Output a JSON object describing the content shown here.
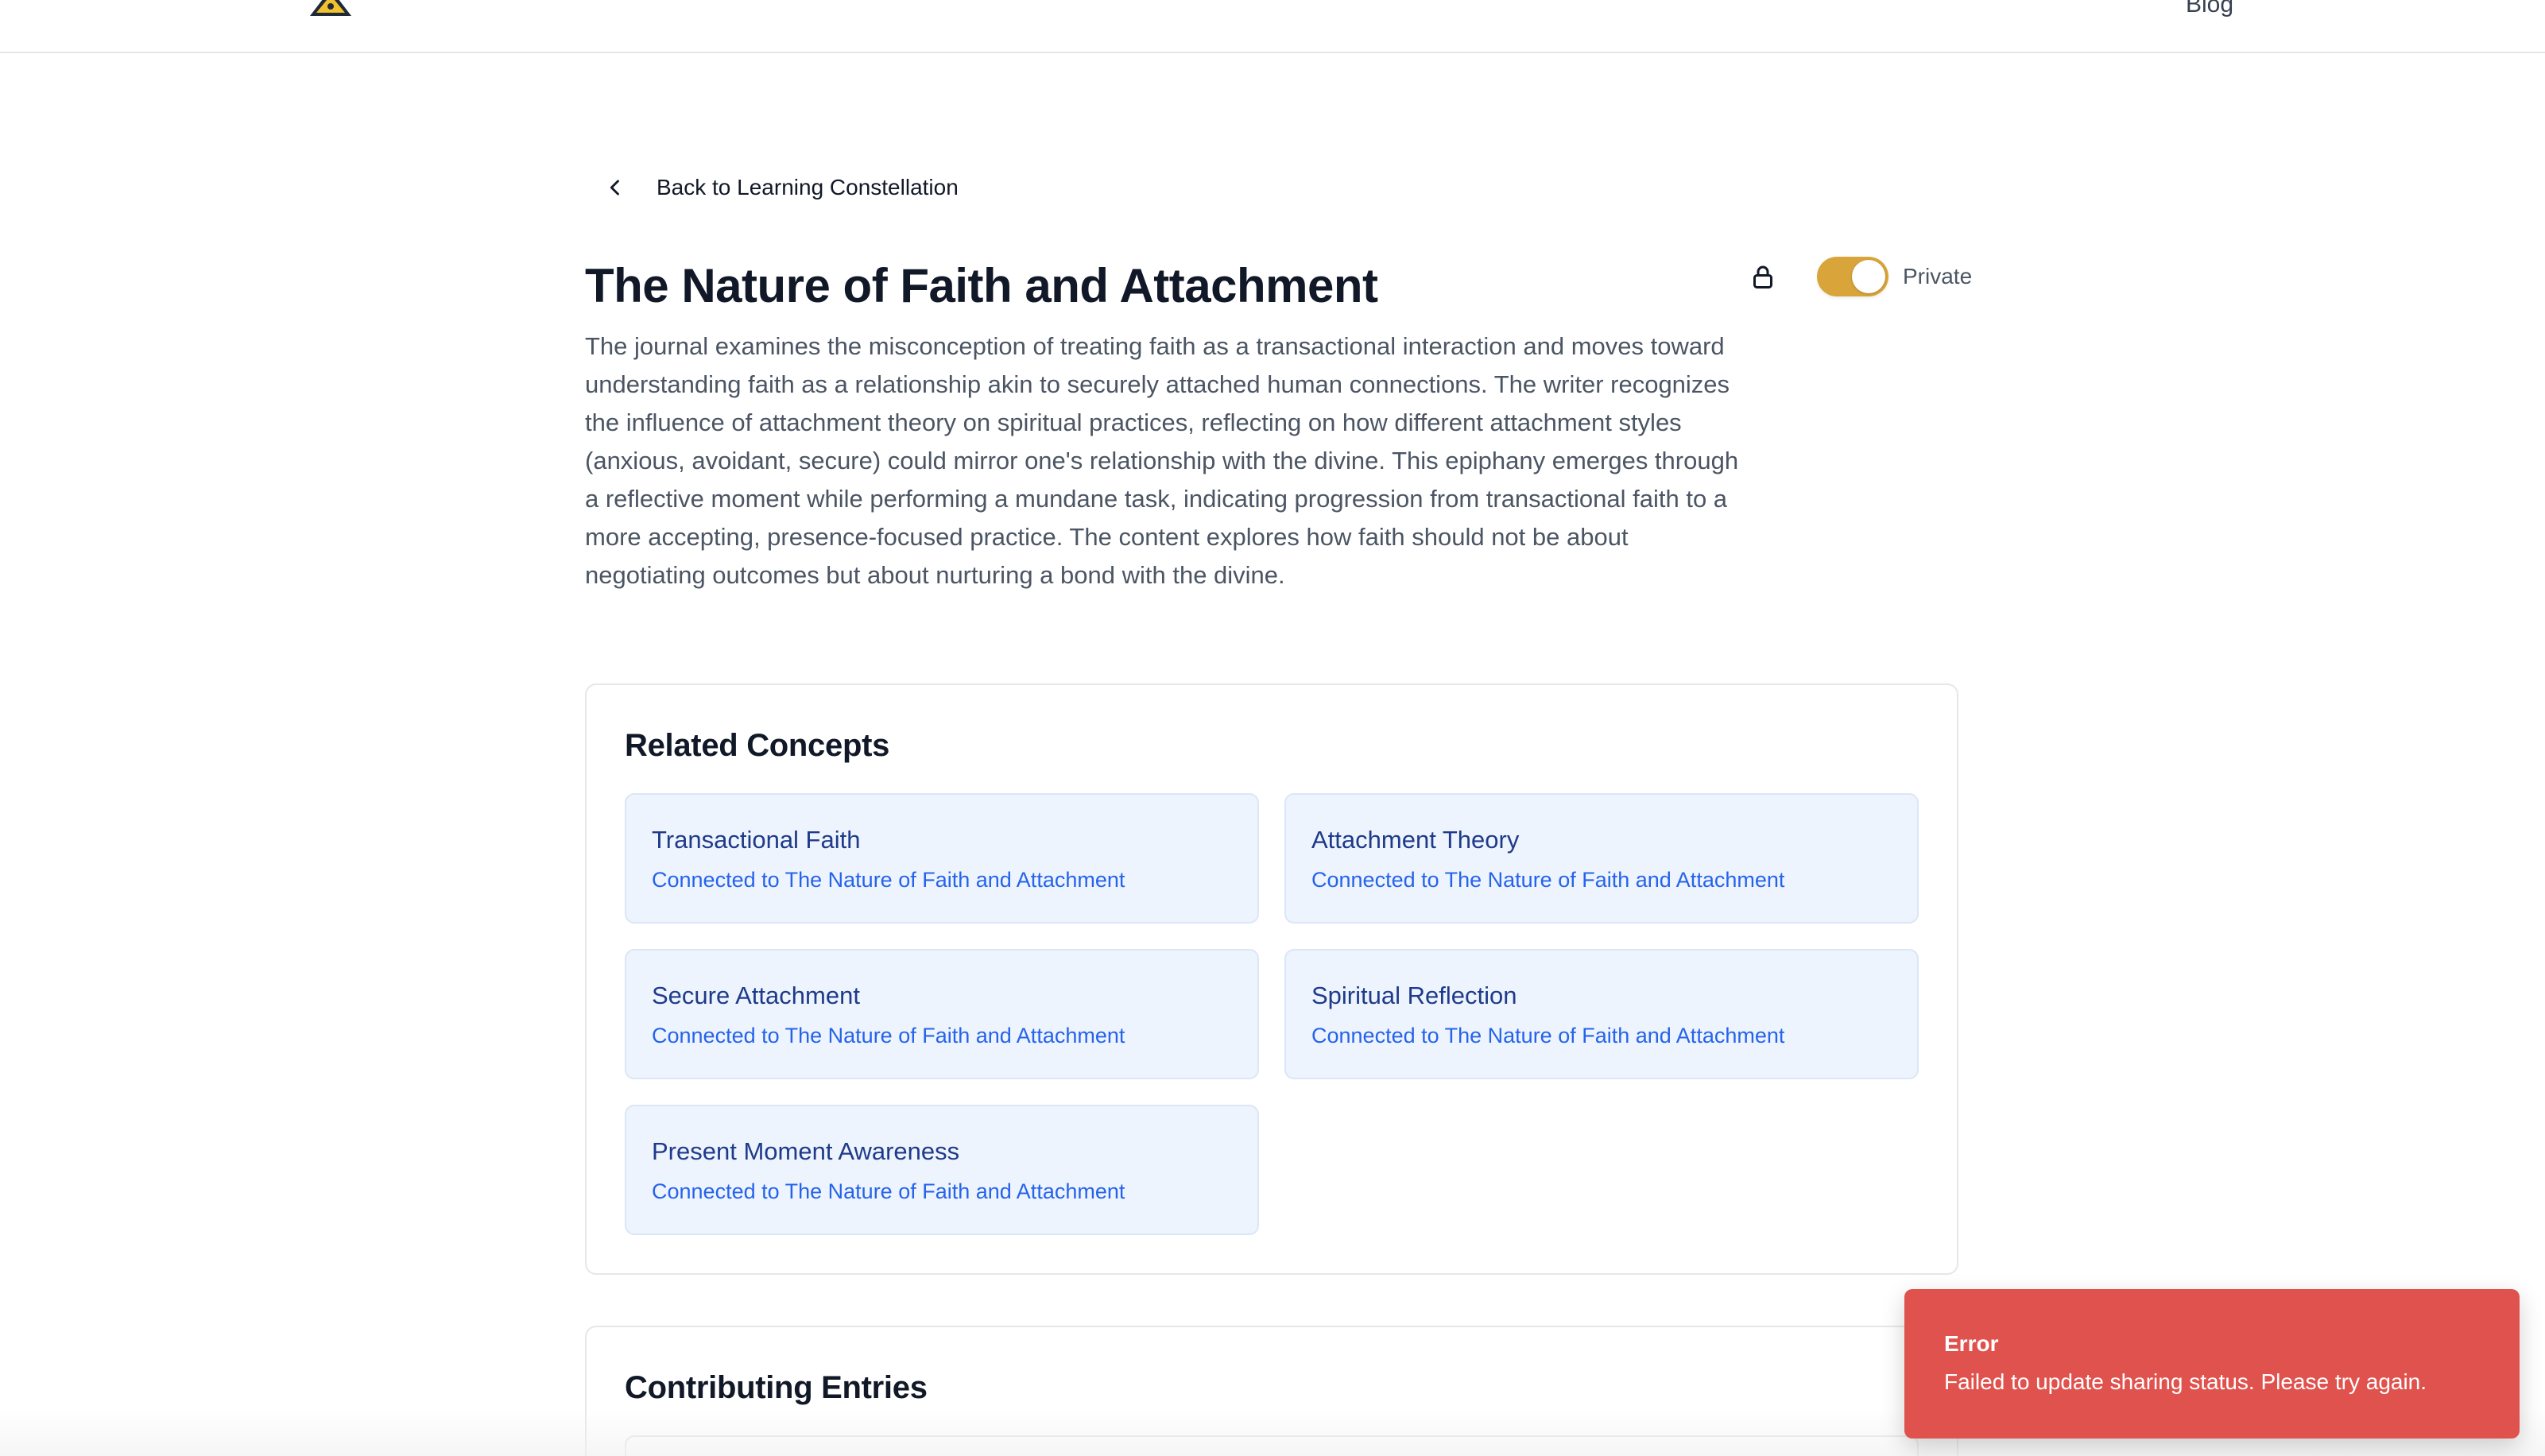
{
  "nav": {
    "logo_icon": "hazard-logo-icon",
    "blog_label": "Blog"
  },
  "back_link": {
    "label": "Back to Learning Constellation",
    "icon": "chevron-left-icon"
  },
  "header": {
    "title": "The Nature of Faith and Attachment",
    "privacy": {
      "icon": "lock-icon",
      "toggle_on": true,
      "label": "Private",
      "accent_color": "#d9a53a"
    }
  },
  "description": "The journal examines the misconception of treating faith as a transactional interaction and moves toward understanding faith as a relationship akin to securely attached human connections. The writer recognizes the influence of attachment theory on spiritual practices, reflecting on how different attachment styles (anxious, avoidant, secure) could mirror one's relationship with the divine. This epiphany emerges through a reflective moment while performing a mundane task, indicating progression from transactional faith to a more accepting, presence-focused practice. The content explores how faith should not be about negotiating outcomes but about nurturing a bond with the divine.",
  "related_concepts": {
    "title": "Related Concepts",
    "items": [
      {
        "name": "Transactional Faith",
        "subtitle": "Connected to The Nature of Faith and Attachment"
      },
      {
        "name": "Attachment Theory",
        "subtitle": "Connected to The Nature of Faith and Attachment"
      },
      {
        "name": "Secure Attachment",
        "subtitle": "Connected to The Nature of Faith and Attachment"
      },
      {
        "name": "Spiritual Reflection",
        "subtitle": "Connected to The Nature of Faith and Attachment"
      },
      {
        "name": "Present Moment Awareness",
        "subtitle": "Connected to The Nature of Faith and Attachment"
      }
    ]
  },
  "contributing_entries": {
    "title": "Contributing Entries"
  },
  "toast": {
    "title": "Error",
    "message": "Failed to update sharing status. Please try again.",
    "color": "#e0524d"
  }
}
